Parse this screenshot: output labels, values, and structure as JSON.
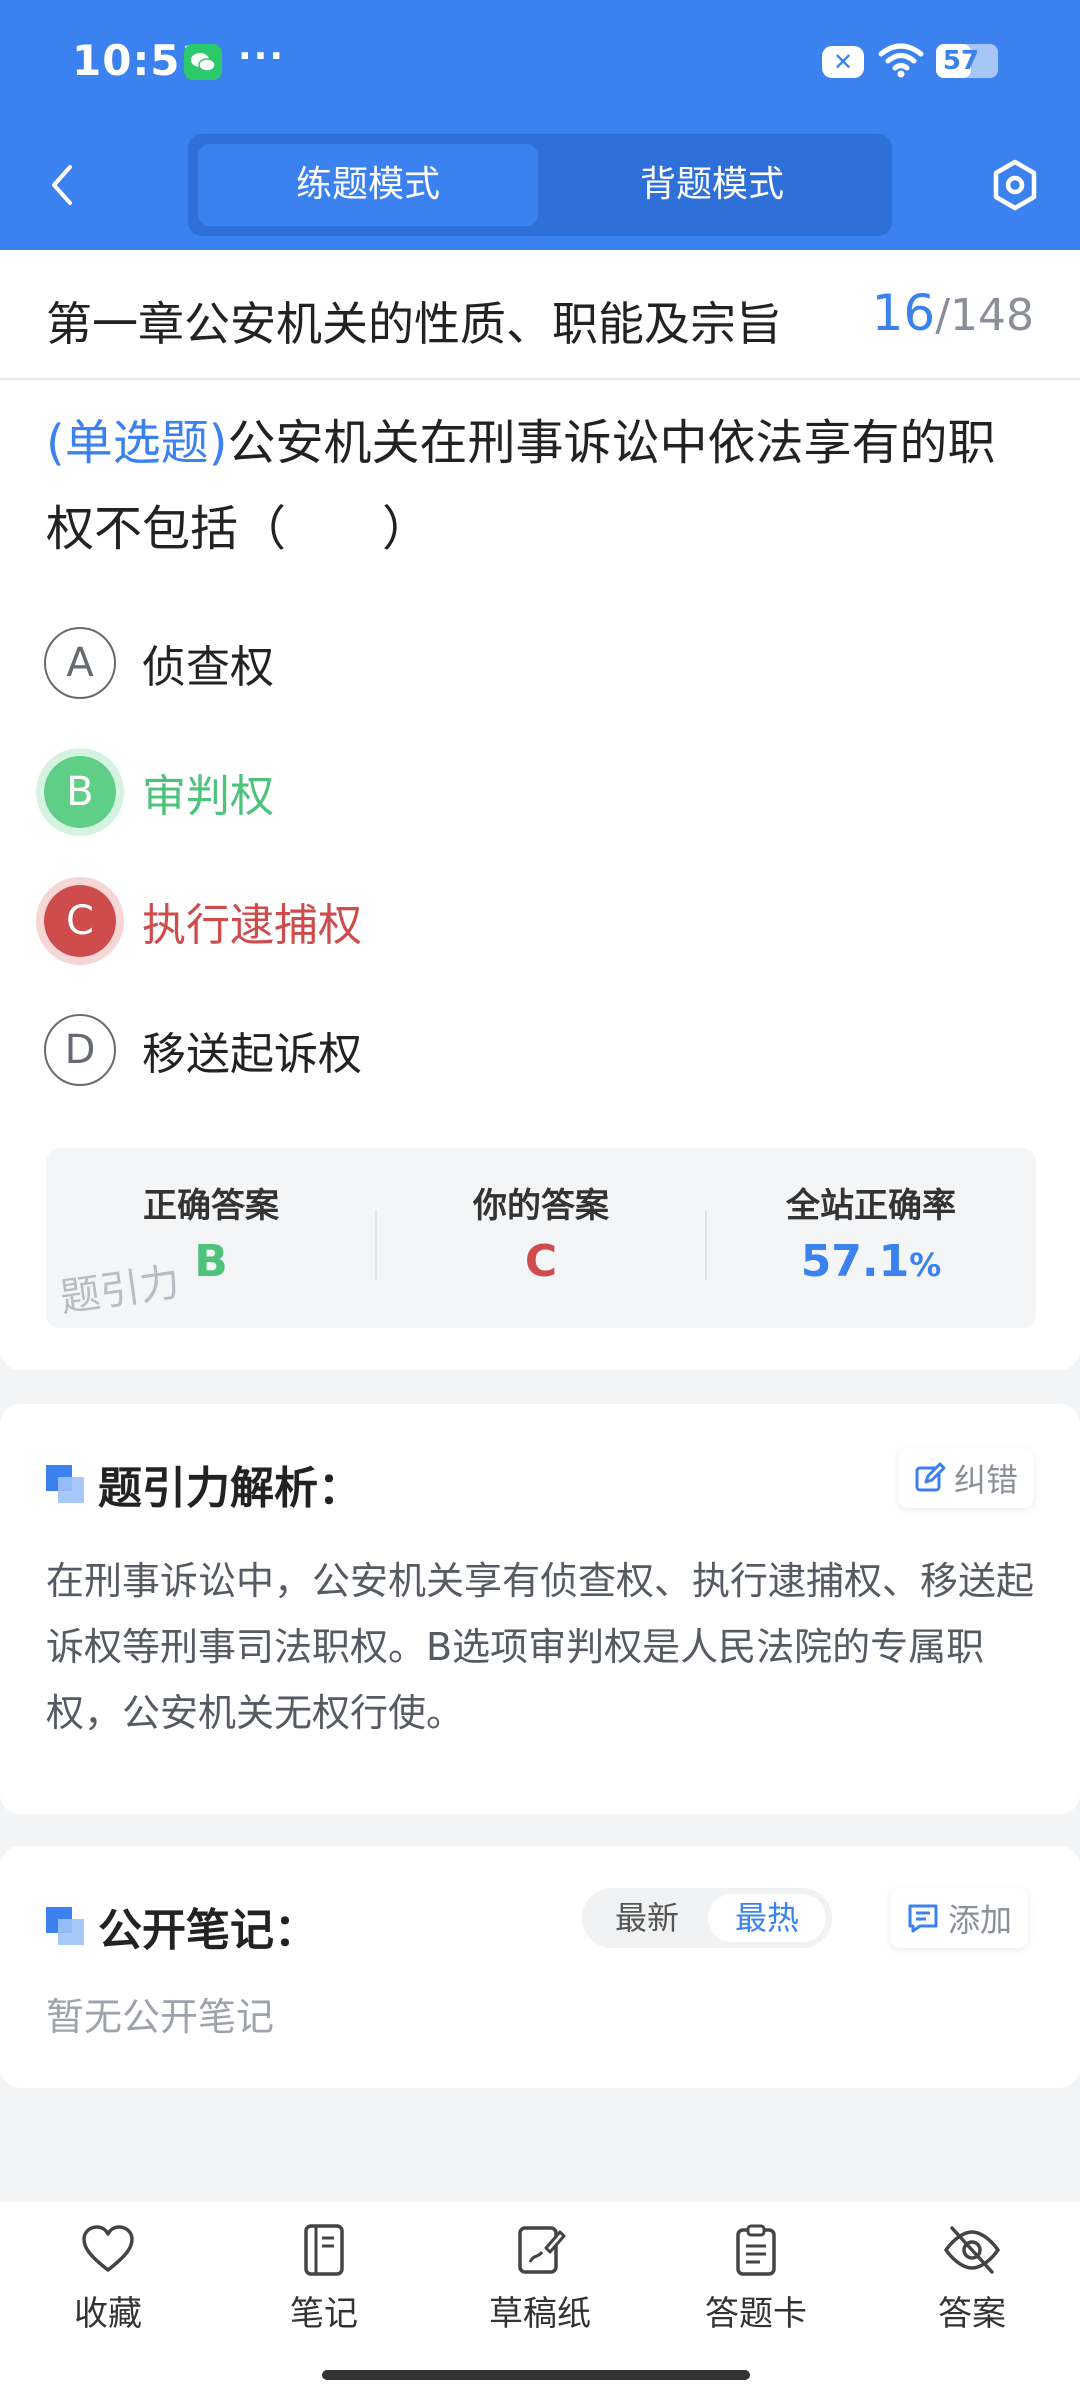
{
  "status": {
    "time": "10:51",
    "more": "···",
    "battery": "57",
    "battery_level_pct": 57
  },
  "header": {
    "modes": [
      {
        "label": "练题模式"
      },
      {
        "label": "背题模式"
      }
    ]
  },
  "chapter": {
    "title": "第一章公安机关的性质、职能及宗旨",
    "current": "16",
    "separator": "/",
    "total": "148"
  },
  "question": {
    "type": "(单选题)",
    "text": "公安机关在刑事诉讼中依法享有的职权不包括（　　）",
    "options": [
      {
        "letter": "A",
        "text": "侦查权"
      },
      {
        "letter": "B",
        "text": "审判权"
      },
      {
        "letter": "C",
        "text": "执行逮捕权"
      },
      {
        "letter": "D",
        "text": "移送起诉权"
      }
    ]
  },
  "stats": {
    "correct_label": "正确答案",
    "correct_value": "B",
    "yours_label": "你的答案",
    "yours_value": "C",
    "rate_label": "全站正确率",
    "rate_value": "57.1",
    "rate_unit": "%",
    "watermark": "题引力"
  },
  "analysis": {
    "title": "题引力解析：",
    "report_label": "纠错",
    "text": "在刑事诉讼中，公安机关享有侦查权、执行逮捕权、移送起诉权等刑事司法职权。B选项审判权是人民法院的专属职权，公安机关无权行使。"
  },
  "notes": {
    "title": "公开笔记：",
    "sort_latest": "最新",
    "sort_hot": "最热",
    "add_label": "添加",
    "empty": "暂无公开笔记"
  },
  "bottom_tabs": [
    {
      "label": "收藏"
    },
    {
      "label": "笔记"
    },
    {
      "label": "草稿纸"
    },
    {
      "label": "答题卡"
    },
    {
      "label": "答案"
    }
  ],
  "colors": {
    "primary": "#3b82f0",
    "correct": "#4cc27b",
    "wrong": "#cf4c4c"
  }
}
